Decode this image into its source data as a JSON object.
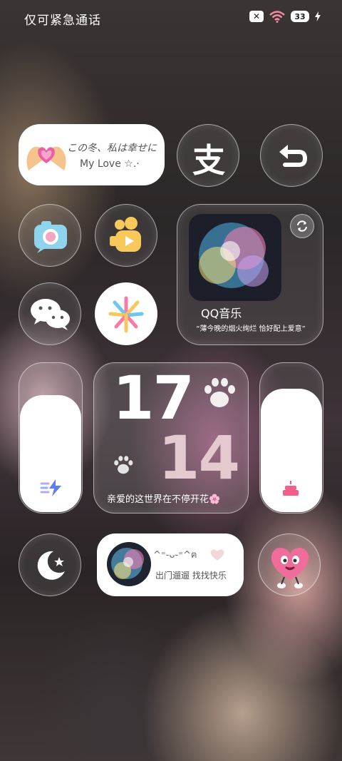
{
  "status_bar": {
    "left_text": "仅可紧急通话",
    "x_badge": "✕",
    "battery": "33"
  },
  "love_widget": {
    "line1": "この冬、私は幸せに",
    "line2": "My Love ☆.·"
  },
  "icons": {
    "alipay": "支",
    "back": "back-arrow-icon",
    "camera": "camera-icon",
    "video": "video-icon",
    "wechat": "wechat-icon",
    "fireworks": "fireworks-icon"
  },
  "music_widget": {
    "title": "QQ音乐",
    "subtitle": "“薄今晚的烟火绚烂 恰好配上爱意”"
  },
  "clock_widget": {
    "hour": "17",
    "minute": "14",
    "caption": "亲爱的这世界在不停开花🌸"
  },
  "mini_widget": {
    "line1": "^⁼-ᴗ-⁼^ฅ",
    "line2": "出门遛遛 找找快乐"
  }
}
